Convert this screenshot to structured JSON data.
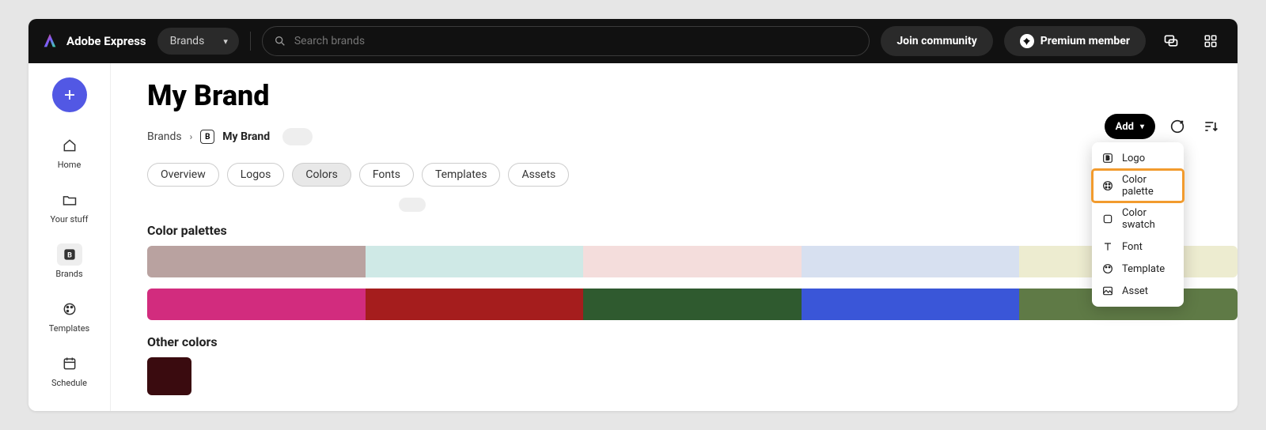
{
  "header": {
    "product_name": "Adobe Express",
    "brands_selector": "Brands",
    "search_placeholder": "Search brands",
    "join_label": "Join community",
    "premium_label": "Premium member"
  },
  "sidebar": {
    "items": [
      {
        "label": "Home"
      },
      {
        "label": "Your stuff"
      },
      {
        "label": "Brands"
      },
      {
        "label": "Templates"
      },
      {
        "label": "Schedule"
      }
    ]
  },
  "page": {
    "title": "My Brand",
    "breadcrumb_root": "Brands",
    "breadcrumb_current": "My Brand",
    "tabs": [
      {
        "label": "Overview"
      },
      {
        "label": "Logos"
      },
      {
        "label": "Colors"
      },
      {
        "label": "Fonts"
      },
      {
        "label": "Templates"
      },
      {
        "label": "Assets"
      }
    ],
    "active_tab_index": 2,
    "add_label": "Add",
    "section_palettes_title": "Color palettes",
    "section_other_title": "Other colors",
    "palettes": [
      {
        "colors": [
          "#b9a2a0",
          "#cfe9e6",
          "#f4dddc",
          "#d7e0f0",
          "#edecd0"
        ]
      },
      {
        "colors": [
          "#d22c7e",
          "#a51d1d",
          "#2f5a2f",
          "#3a56d8",
          "#5f7a46"
        ]
      }
    ],
    "other_colors": [
      "#3a0b0f"
    ],
    "add_menu": [
      {
        "label": "Logo"
      },
      {
        "label": "Color palette"
      },
      {
        "label": "Color swatch"
      },
      {
        "label": "Font"
      },
      {
        "label": "Template"
      },
      {
        "label": "Asset"
      }
    ],
    "highlighted_menu_index": 1
  }
}
